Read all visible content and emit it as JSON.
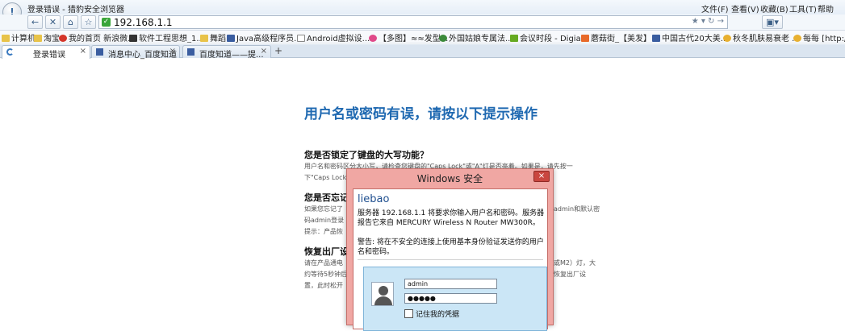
{
  "window": {
    "title": "登录错误 - 猎豹安全浏览器",
    "menus": [
      "文件(F)",
      "查看(V)",
      "收藏(B)",
      "工具(T)",
      "帮助"
    ]
  },
  "navbar": {
    "back_icon": "back-arrow-icon",
    "close_icon": "close-icon",
    "home_icon": "home-icon",
    "star_icon": "star-icon",
    "address": "192.168.1.1"
  },
  "bookmarks": [
    {
      "label": "计算机",
      "color": "#e8c34a"
    },
    {
      "label": "淘宝",
      "color": "#e8c34a"
    },
    {
      "label": "我的首页 新浪微...",
      "color": "#d4352a"
    },
    {
      "label": "软件工程思想_1...",
      "color": "#333333"
    },
    {
      "label": "舞蹈",
      "color": "#e8c34a"
    },
    {
      "label": "Java高级程序员...",
      "color": "#3a5da0"
    },
    {
      "label": "Android虚拟设...",
      "color": "#888888"
    },
    {
      "label": "【多图】≈≈发型...",
      "color": "#e04a8a"
    },
    {
      "label": "外国姑娘专属法...",
      "color": "#3b8a3b"
    },
    {
      "label": "会议时段 - Digia...",
      "color": "#66aa22"
    },
    {
      "label": "蘑菇街_【美发】...",
      "color": "#e86a2a"
    },
    {
      "label": "中国古代20大美...",
      "color": "#3a5da0"
    },
    {
      "label": "秋冬肌肤易衰老 ...",
      "color": "#e8b030"
    },
    {
      "label": "每每 [http://",
      "color": "#e8b030"
    }
  ],
  "tabs": [
    {
      "label": "登录错误",
      "close": "×"
    },
    {
      "label": "消息中心_百度知道",
      "close": "×"
    },
    {
      "label": "百度知道——提...",
      "close": "×"
    }
  ],
  "new_tab": "+",
  "page": {
    "title": "用户名或密码有误，请按以下提示操作",
    "sections": [
      {
        "heading": "您是否锁定了键盘的大写功能？",
        "lines": [
          "用户名和密码区分大小写，请检查您键盘的\"Caps Lock\"或\"A\"灯是否亮着。如果是，请先按一",
          "下\"Caps Lock"
        ]
      },
      {
        "heading": "您是否忘记",
        "lines": [
          "如果您忘记了",
          "码admin登录",
          "提示：产品恢"
        ],
        "right_lines": [
          "admin和默认密"
        ]
      },
      {
        "heading": "恢复出厂设",
        "lines": [
          "请在产品通电",
          "约等待5秒钟后",
          "置，此时松开"
        ],
        "right_lines": [
          "或M2）灯，大",
          "恢复出厂设"
        ]
      }
    ]
  },
  "dialog": {
    "title": "Windows 安全",
    "close": "×",
    "user": "liebao",
    "message": "服务器 192.168.1.1 将要求你输入用户名和密码。服务器报告它来自 MERCURY Wireless N Router MW300R。",
    "warning": "警告: 将在不安全的连接上使用基本身份验证发送你的用户名和密码。",
    "username_value": "admin",
    "password_value": "●●●●●",
    "remember_label": "记住我的凭据"
  }
}
